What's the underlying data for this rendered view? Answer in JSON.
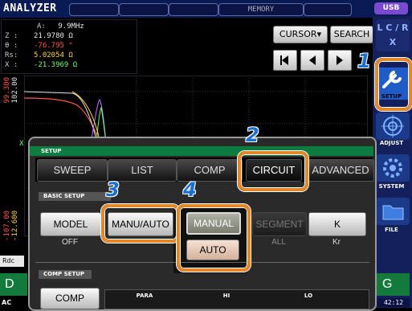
{
  "header": {
    "title": "ANALYZER",
    "memory_label": "MEMORY",
    "usb_label": "USB"
  },
  "readout": {
    "freq_label": "A:",
    "freq_value": "9.9MHz",
    "rows": [
      {
        "label": "Z :",
        "value": "21.9780 Ω"
      },
      {
        "label": "θ :",
        "value": "-76.795 °"
      },
      {
        "label": "Rs:",
        "value": "5.02054 Ω"
      },
      {
        "label": "X :",
        "value": "-21.3969 Ω"
      }
    ]
  },
  "graph_axis": {
    "left_top_a": "99.300",
    "left_top_b": "102.00",
    "left_bottom_a": "-107.00",
    "left_bottom_b": "-12.600",
    "left_mid": "X"
  },
  "toolbar": {
    "cursor_label": "CURSOR▾",
    "search_label": "SEARCH"
  },
  "sidebar": {
    "setup": "SETUP",
    "adjust": "ADJUST",
    "system": "SYSTEM",
    "file": "FILE",
    "lc_icon": "L C / R X",
    "clock": "42:12"
  },
  "bottom": {
    "left_d": "D",
    "right_g": "G",
    "left_ac": "AC",
    "left_rdc": "Rdc"
  },
  "panel": {
    "header": "SETUP",
    "tabs": [
      "SWEEP",
      "LIST",
      "COMP",
      "CIRCUIT",
      "ADVANCED"
    ],
    "basic_setup_label": "BASIC SETUP",
    "model": {
      "label": "MODEL",
      "value": "OFF"
    },
    "manu_auto": {
      "label": "MANU/AUTO"
    },
    "manual_label": "MANUAL",
    "auto_label": "AUTO",
    "segment": {
      "label": "SEGMENT",
      "value": "ALL"
    },
    "k": {
      "label": "K",
      "value": "Kr"
    },
    "comp_setup_label": "COMP SETUP",
    "comp_button": "COMP",
    "table_headers": [
      "PARA",
      "HI",
      "LO"
    ]
  },
  "callouts": [
    "1",
    "2",
    "3",
    "4"
  ],
  "colors": {
    "accent": "#e0882a",
    "callout": "#1d6fd1",
    "panel_header": "#0c7d3f"
  }
}
